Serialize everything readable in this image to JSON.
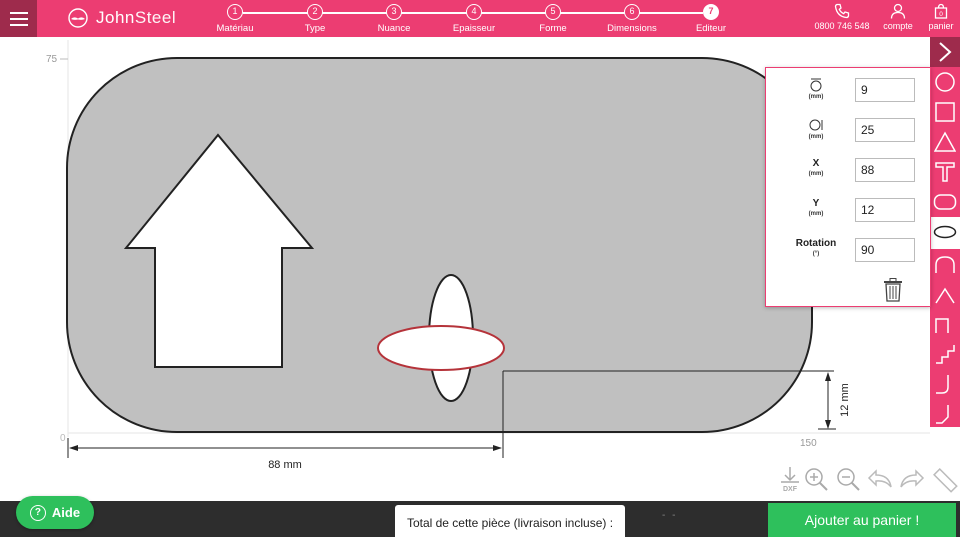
{
  "brand": {
    "name_light": "John",
    "name_strong": "Steel"
  },
  "steps": [
    {
      "num": "1",
      "label": "Matériau"
    },
    {
      "num": "2",
      "label": "Type"
    },
    {
      "num": "3",
      "label": "Nuance"
    },
    {
      "num": "4",
      "label": "Epaisseur"
    },
    {
      "num": "5",
      "label": "Forme"
    },
    {
      "num": "6",
      "label": "Dimensions"
    },
    {
      "num": "7",
      "label": "Editeur"
    }
  ],
  "active_step": 7,
  "header_right": {
    "phone": "0800 746 548",
    "account": "compte",
    "cart": "panier",
    "cart_count": "0"
  },
  "canvas": {
    "y_tick": "75",
    "x_tick_0": "0",
    "x_tick_150": "150",
    "dim_horizontal": "88 mm",
    "dim_vertical": "12 mm"
  },
  "panel": {
    "fields": [
      {
        "label": "",
        "unit": "(mm)",
        "value": "9",
        "icon": "height-icon"
      },
      {
        "label": "",
        "unit": "(mm)",
        "value": "25",
        "icon": "width-icon"
      },
      {
        "label": "X",
        "unit": "(mm)",
        "value": "88",
        "icon": ""
      },
      {
        "label": "Y",
        "unit": "(mm)",
        "value": "12",
        "icon": ""
      },
      {
        "label": "Rotation",
        "unit": "(°)",
        "value": "90",
        "icon": ""
      }
    ]
  },
  "toolbar": {
    "tools": [
      "select-arrow-icon",
      "circle-tool-icon",
      "square-tool-icon",
      "triangle-tool-icon",
      "text-tool-icon",
      "rounded-rect-tool-icon",
      "ellipse-tool-icon",
      "round-notch-icon",
      "chamfer-notch-icon",
      "square-notch-icon",
      "step-notch-icon",
      "rounded-corner-icon",
      "chamfer-corner-icon"
    ]
  },
  "bottom_tools": {
    "dxf_label": "DXF"
  },
  "footer": {
    "total_label": "Total de cette pièce (livraison incluse) :",
    "total_value": "- -",
    "add_to_cart": "Ajouter au panier !",
    "help": "Aide"
  },
  "colors": {
    "brand_pink": "#ec3d72",
    "brand_dark": "#9e2b4c",
    "green": "#2ec05c",
    "footer": "#2d2d2d",
    "shape_fill": "#c0c0c0",
    "selected_stroke": "#b5333a"
  }
}
